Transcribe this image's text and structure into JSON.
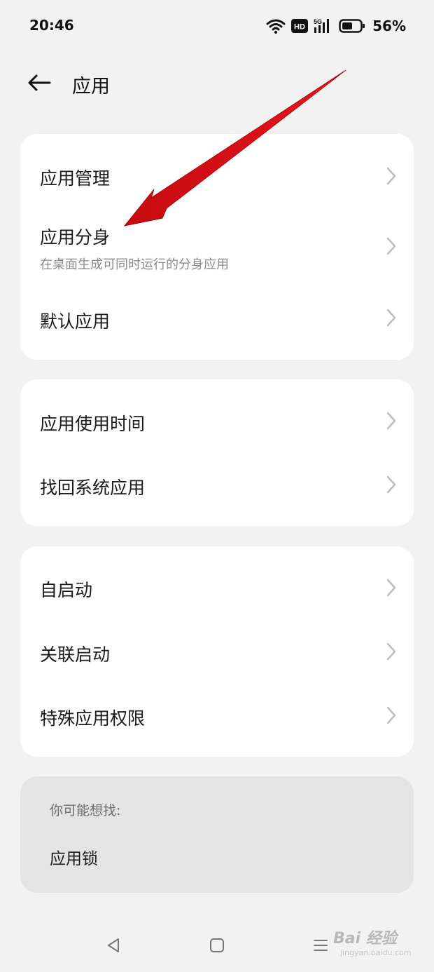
{
  "status_bar": {
    "time": "20:46",
    "network_hd": "HD",
    "network_type": "5G",
    "battery_percent": "56%",
    "battery_level": 0.56,
    "icons": [
      "wifi-icon",
      "hd-icon",
      "signal-5g-icon",
      "battery-icon"
    ]
  },
  "header": {
    "title": "应用",
    "back_icon": "back-arrow-icon"
  },
  "groups": [
    {
      "items": [
        {
          "label": "应用管理"
        },
        {
          "label": "应用分身",
          "subtitle": "在桌面生成可同时运行的分身应用"
        },
        {
          "label": "默认应用"
        }
      ]
    },
    {
      "items": [
        {
          "label": "应用使用时间"
        },
        {
          "label": "找回系统应用"
        }
      ]
    },
    {
      "items": [
        {
          "label": "自启动"
        },
        {
          "label": "关联启动"
        },
        {
          "label": "特殊应用权限"
        }
      ]
    }
  ],
  "suggestions": {
    "title": "你可能想找:",
    "items": [
      "应用锁"
    ]
  },
  "nav_bar": {
    "icons": [
      "back-triangle-icon",
      "home-square-icon",
      "recents-menu-icon"
    ]
  },
  "annotation": {
    "color": "#e8161c"
  },
  "watermark": {
    "text": "Bai 经验",
    "sub": "jingyan.baidu.com"
  }
}
